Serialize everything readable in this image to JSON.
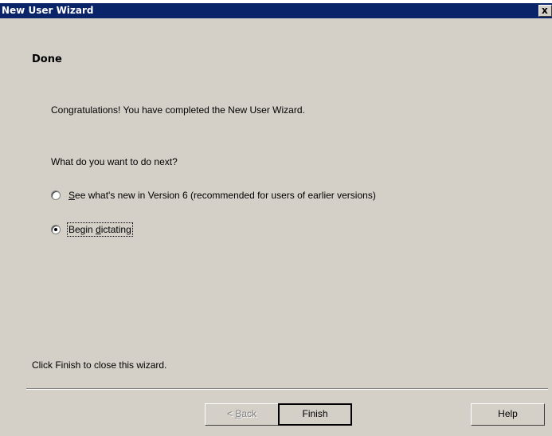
{
  "window": {
    "title": "New User Wizard",
    "close_label": "x"
  },
  "page": {
    "heading": "Done",
    "congrats": "Congratulations!  You have completed the New User Wizard.",
    "question": "What do you want to do next?",
    "options": [
      {
        "prefix": "",
        "accel": "S",
        "rest": "ee what's new in Version 6 (recommended for users of earlier versions)",
        "selected": false
      },
      {
        "prefix": "Begin ",
        "accel": "d",
        "rest": "ictating",
        "selected": true
      }
    ],
    "footer_text": "Click Finish to close this wizard."
  },
  "buttons": {
    "back_prefix": "< ",
    "back_accel": "B",
    "back_rest": "ack",
    "finish": "Finish",
    "help": "Help"
  },
  "colors": {
    "titlebar": "#0a246a",
    "dialog_bg": "#d4d0c8"
  }
}
